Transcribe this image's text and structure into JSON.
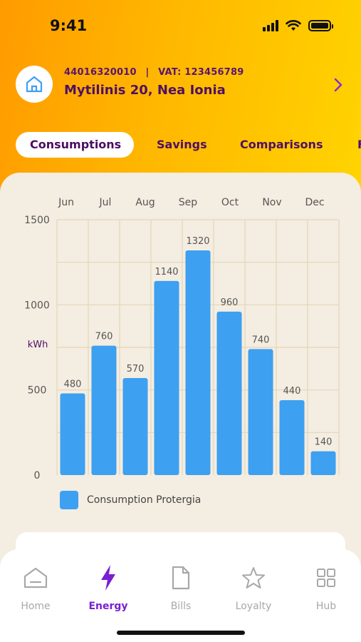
{
  "status_bar": {
    "time": "9:41"
  },
  "account": {
    "number": "44016320010",
    "separator": "|",
    "vat": "VAT: 123456789",
    "address": "Mytilinis 20, Nea Ionia"
  },
  "tabs": [
    {
      "label": "Consumptions",
      "active": true
    },
    {
      "label": "Savings",
      "active": false
    },
    {
      "label": "Comparisons",
      "active": false
    },
    {
      "label": "F",
      "active": false
    }
  ],
  "chart_data": {
    "type": "bar",
    "categories": [
      "Jun",
      "Jul",
      "Aug",
      "Sep",
      "Oct",
      "Nov",
      "Dec"
    ],
    "values": [
      480,
      760,
      570,
      1140,
      1320,
      960,
      740,
      440,
      140
    ],
    "ylabel": "kWh",
    "ylim": [
      0,
      1500
    ],
    "yticks": [
      "0",
      "500",
      "1000",
      "1500"
    ],
    "series": [
      {
        "name": "Consumption Protergia"
      }
    ],
    "bar_color": "#3da0f0",
    "grid": true,
    "legend_position": "bottom-left"
  },
  "legend": {
    "label": "Consumption Protergia"
  },
  "bottom_nav": {
    "items": [
      {
        "label": "Home",
        "icon": "home-outline-icon",
        "active": false
      },
      {
        "label": "Energy",
        "icon": "lightning-bolt-icon",
        "active": true
      },
      {
        "label": "Bills",
        "icon": "document-icon",
        "active": false
      },
      {
        "label": "Loyalty",
        "icon": "star-icon",
        "active": false
      },
      {
        "label": "Hub",
        "icon": "grid-icon",
        "active": false
      }
    ]
  },
  "colors": {
    "brand_purple": "#4e0f63",
    "accent_violet": "#7a1fd1",
    "bar_blue": "#3da0f0",
    "header_orange": "#ff9b00",
    "header_yellow": "#ffd400"
  }
}
